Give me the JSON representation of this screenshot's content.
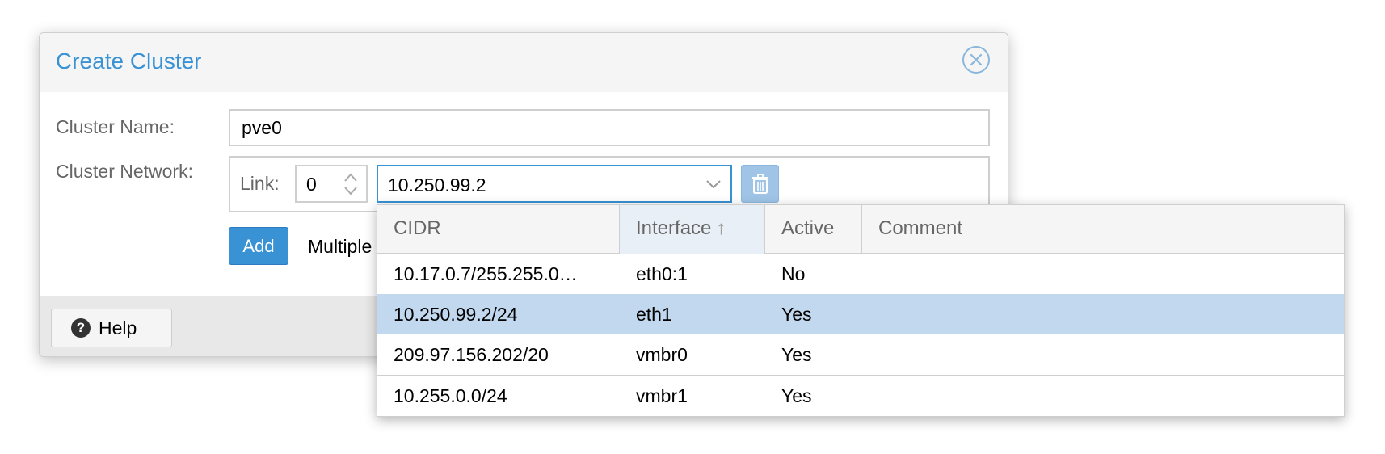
{
  "dialog": {
    "title": "Create Cluster",
    "close_icon": "close-circle-icon",
    "cluster_name_label": "Cluster Name:",
    "cluster_name_value": "pve0",
    "cluster_network_label": "Cluster Network:",
    "link_label": "Link:",
    "link_value": "0",
    "network_value": "10.250.99.2",
    "delete_icon": "trash-icon",
    "add_label": "Add",
    "multiple_text": "Multiple",
    "help_label": "Help",
    "help_icon": "question-circle-icon"
  },
  "dropdown": {
    "columns": [
      "CIDR",
      "Interface",
      "Active",
      "Comment"
    ],
    "sort_indicator": "↑",
    "rows": [
      {
        "cidr": "10.17.0.7/255.255.0…",
        "interface": "eth0:1",
        "active": "No",
        "comment": ""
      },
      {
        "cidr": "10.250.99.2/24",
        "interface": "eth1",
        "active": "Yes",
        "comment": ""
      },
      {
        "cidr": "209.97.156.202/20",
        "interface": "vmbr0",
        "active": "Yes",
        "comment": ""
      },
      {
        "cidr": "10.255.0.0/24",
        "interface": "vmbr1",
        "active": "Yes",
        "comment": ""
      }
    ]
  },
  "colors": {
    "accent": "#3892d4",
    "selected_row": "#c2d8ee",
    "delete_button": "#9fc4e6"
  }
}
